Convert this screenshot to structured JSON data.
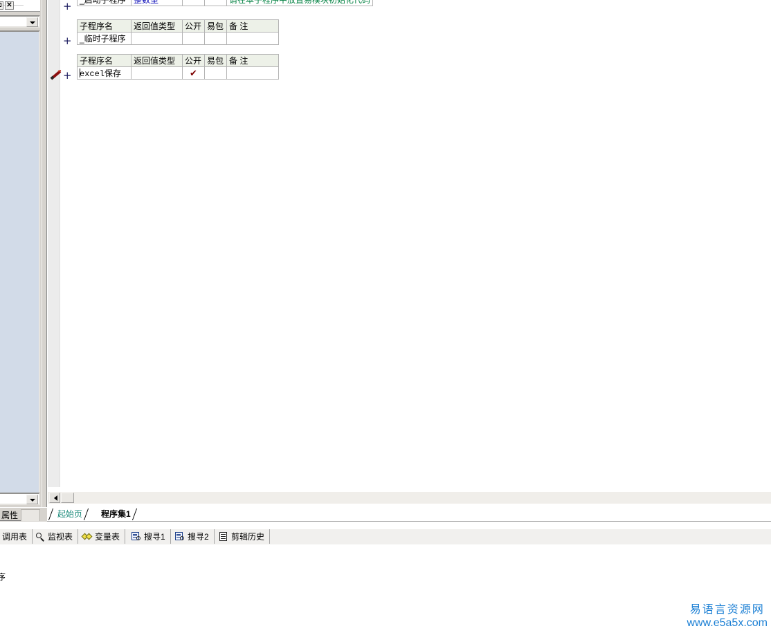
{
  "window": {
    "restore_label": "□",
    "close_label": "✕"
  },
  "properties_panel": {
    "tab_label": "属性",
    "combo_value": "",
    "combo2_value": ""
  },
  "editor": {
    "tables": [
      {
        "id": "startup",
        "has_headers": false,
        "rows": [
          {
            "name": "_启动子程序",
            "rettype": "整数型",
            "public": "",
            "pack": "",
            "note": "请在本子程序中放置易模块初始化代码"
          }
        ]
      },
      {
        "id": "temp",
        "has_headers": true,
        "headers": {
          "name": "子程序名",
          "rettype": "返回值类型",
          "public": "公开",
          "pack": "易包",
          "note": "备 注"
        },
        "rows": [
          {
            "name": "_临时子程序",
            "rettype": "",
            "public": "",
            "pack": "",
            "note": ""
          }
        ]
      },
      {
        "id": "excel",
        "has_headers": true,
        "headers": {
          "name": "子程序名",
          "rettype": "返回值类型",
          "public": "公开",
          "pack": "易包",
          "note": "备 注"
        },
        "rows": [
          {
            "name": "excel保存",
            "rettype": "",
            "public": "✔",
            "pack": "",
            "note": ""
          }
        ]
      }
    ],
    "expand_marker": "+"
  },
  "document_tabs": [
    {
      "label": "起始页",
      "active": false
    },
    {
      "label": "程序集1",
      "active": true
    }
  ],
  "bottom_tabs": [
    {
      "label": "调用表",
      "icon": "none"
    },
    {
      "label": "监视表",
      "icon": "magnifier-icon"
    },
    {
      "label": "变量表",
      "icon": "diamonds-icon"
    },
    {
      "label": "搜寻1",
      "icon": "search-book-icon"
    },
    {
      "label": "搜寻2",
      "icon": "search-book-icon"
    },
    {
      "label": "剪辑历史",
      "icon": "clipboard-icon"
    }
  ],
  "output_pane": {
    "text": "序"
  },
  "watermark": {
    "cn": "易语言资源网",
    "url": "www.e5a5x.com",
    "color": "#1b7fd4"
  },
  "colors": {
    "header_bg": "#edf1e8",
    "rettype_text": "#0000b4",
    "note_text": "#008040",
    "check_mark": "#7d0000",
    "active_tab_text": "#000000",
    "inactive_tab_text": "#1a8a7a",
    "props_grid_bg": "#d2dbe8"
  }
}
